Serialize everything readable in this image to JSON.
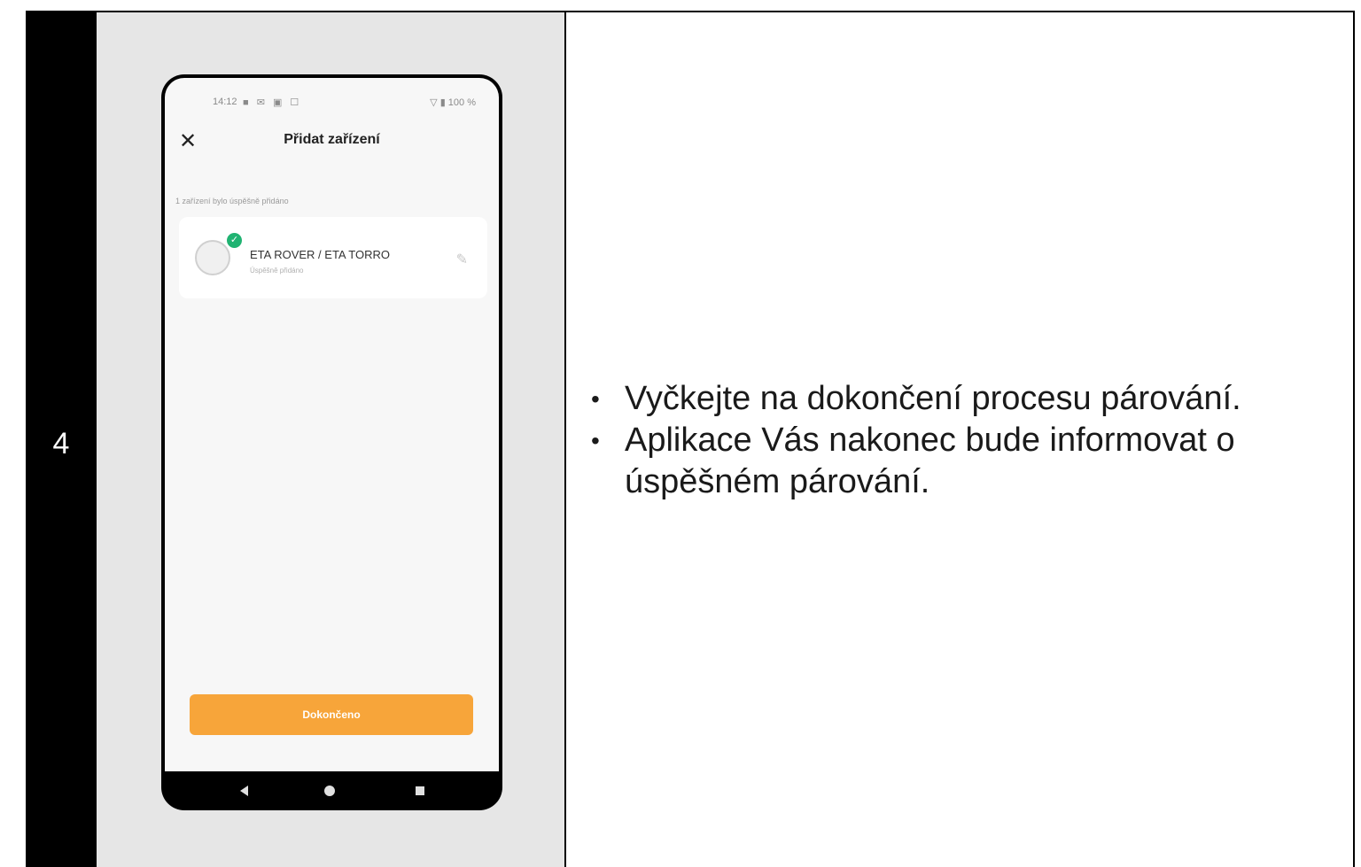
{
  "step": {
    "number": "4"
  },
  "phone": {
    "status_bar": {
      "time": "14:12",
      "icons_left": "■ ✉ ▣ ☐",
      "right": "▽ ▮ 100 %"
    },
    "header": {
      "close_icon": "close-icon",
      "title": "Přidat zařízení"
    },
    "added_note": "1 zařízení bylo úspěšně přidáno",
    "device": {
      "name": "ETA ROVER / ETA TORRO",
      "status": "Úspěšně přidáno",
      "badge_icon": "check-icon",
      "edit_icon": "pencil-icon"
    },
    "done_label": "Dokončeno",
    "nav": {
      "back_icon": "triangle-back-icon",
      "home_icon": "circle-home-icon",
      "recent_icon": "square-recent-icon"
    }
  },
  "instructions": [
    "Vyčkejte na dokončení procesu párování.",
    "Aplikace Vás nakonec bude informovat o úspěšném párování."
  ],
  "colors": {
    "accent_button": "#f7a53a",
    "success_badge": "#20b372",
    "panel_gray": "#e6e6e6"
  }
}
